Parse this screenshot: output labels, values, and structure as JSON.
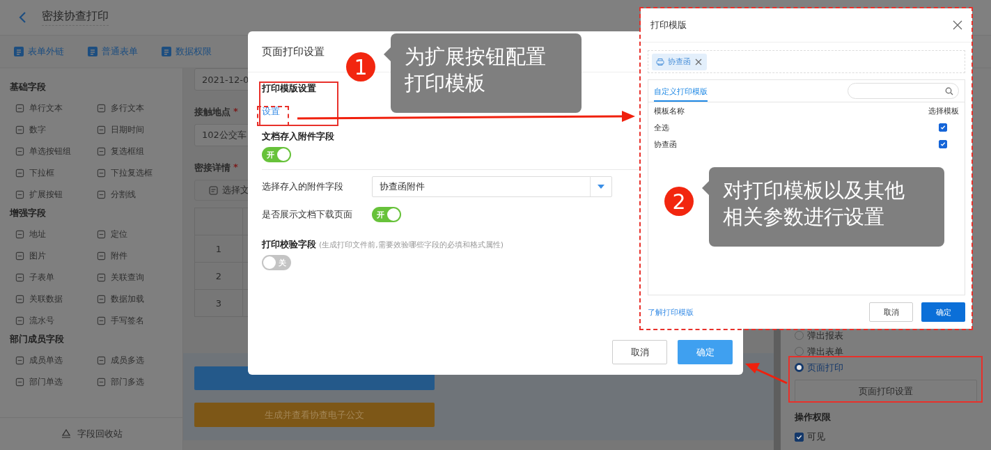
{
  "header": {
    "title": "密接协查打印"
  },
  "toolbar": [
    {
      "label": "表单外链"
    },
    {
      "label": "普通表单"
    },
    {
      "label": "数据权限"
    }
  ],
  "sidebar": {
    "groups": [
      {
        "title": "基础字段",
        "items": [
          "单行文本",
          "多行文本",
          "数字",
          "日期时间",
          "单选按钮组",
          "复选框组",
          "下拉框",
          "下拉复选框",
          "扩展按钮",
          "分割线"
        ]
      },
      {
        "title": "增强字段",
        "items": [
          "地址",
          "定位",
          "图片",
          "附件",
          "子表单",
          "关联查询",
          "关联数据",
          "数据加载",
          "流水号",
          "手写签名"
        ]
      },
      {
        "title": "部门成员字段",
        "items": [
          "成员单选",
          "成员多选",
          "部门单选",
          "部门多选"
        ]
      }
    ],
    "footer": "字段回收站"
  },
  "form": {
    "date_value": "2021-12-0",
    "location": {
      "label": "接触地点",
      "required_mark": "*",
      "value": "102公交车"
    },
    "details": {
      "label": "密接详情",
      "required_mark": "*",
      "select_button": "选择文",
      "rows": [
        "1",
        "2",
        "3"
      ]
    },
    "generate_button": "生成并查看协查电子公文"
  },
  "right_panel": {
    "open_modes": [
      {
        "label": "弹出报表",
        "selected": false
      },
      {
        "label": "弹出表单",
        "selected": false
      },
      {
        "label": "页面打印",
        "selected": true
      }
    ],
    "settings_button": "页面打印设置",
    "permissions_title": "操作权限",
    "permissions": [
      {
        "label": "可见",
        "checked": true
      }
    ]
  },
  "print_dialog": {
    "title": "页面打印设置",
    "template_section": {
      "title": "打印模版设置",
      "link": "设置"
    },
    "attach_section": {
      "title": "文档存入附件字段",
      "toggle": {
        "on": true,
        "label": "开"
      }
    },
    "attach_field": {
      "label": "选择存入的附件字段",
      "value": "协查函附件"
    },
    "show_download": {
      "label": "是否展示文档下载页面",
      "toggle": {
        "on": true,
        "label": "开"
      }
    },
    "verify_section": {
      "title": "打印校验字段",
      "hint": "(生成打印文件前,需要效验哪些字段的必填和格式属性)",
      "toggle": {
        "on": false,
        "label": "关"
      }
    },
    "buttons": [
      {
        "label": "取消",
        "kind": "secondary"
      },
      {
        "label": "确定",
        "kind": "primary"
      }
    ]
  },
  "template_dialog": {
    "title": "打印模版",
    "tags": [
      {
        "label": "协查函"
      }
    ],
    "tabs": [
      {
        "label": "自定义打印模版",
        "selected": true
      }
    ],
    "columns": [
      "模板名称",
      "选择模板"
    ],
    "rows": [
      {
        "name": "全选",
        "checked": true
      },
      {
        "name": "协查函",
        "checked": true
      }
    ],
    "help_link": "了解打印模版",
    "buttons": [
      {
        "label": "取消",
        "kind": "secondary"
      },
      {
        "label": "确定",
        "kind": "primary"
      }
    ]
  },
  "callouts": [
    {
      "number": "1",
      "text": "为扩展按钮配置打印模板"
    },
    {
      "number": "2",
      "text": "对打印模板以及其他相关参数进行设置"
    }
  ]
}
